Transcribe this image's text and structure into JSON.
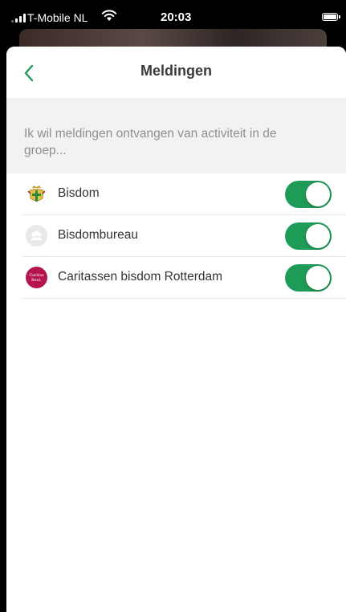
{
  "status_bar": {
    "carrier": "T-Mobile NL",
    "time": "20:03"
  },
  "nav": {
    "title": "Meldingen"
  },
  "section": {
    "text": "Ik wil meldingen ontvangen van activiteit in de groep..."
  },
  "groups": [
    {
      "name": "Bisdom",
      "avatar": "bisdom-crest-icon",
      "enabled": true
    },
    {
      "name": "Bisdombureau",
      "avatar": "group-placeholder-icon",
      "enabled": true
    },
    {
      "name": "Caritassen bisdom Rotterdam",
      "avatar": "caritas-logo",
      "enabled": true,
      "logo_text": [
        "Caritas",
        "Rest."
      ]
    }
  ],
  "colors": {
    "accent": "#1e9b57",
    "caritas": "#b5154f",
    "section_bg": "#f2f2f2"
  }
}
